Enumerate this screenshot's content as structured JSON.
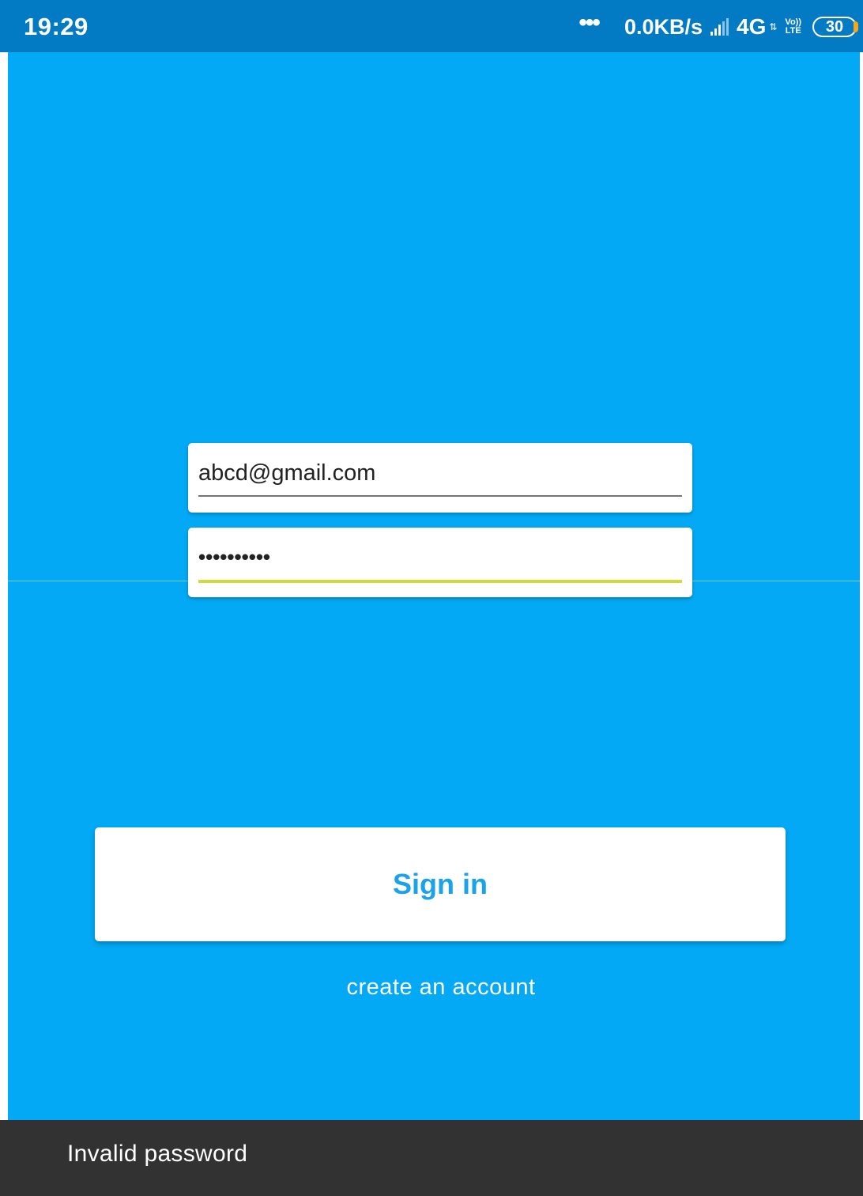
{
  "status_bar": {
    "time": "19:29",
    "dots": "•••",
    "speed": "0.0KB/s",
    "network": "4G",
    "volte_top": "Vo))",
    "volte_bottom": "LTE",
    "battery_level": "30",
    "battery_accent_color": "#f6a81c"
  },
  "login": {
    "email_value": "abcd@gmail.com",
    "password_mask": "••••••••••"
  },
  "buttons": {
    "sign_in_label": "Sign in",
    "create_account_label": "create an account"
  },
  "snackbar": {
    "message": "Invalid password"
  },
  "colors": {
    "status_bar": "#027bc4",
    "background": "#03a9f4",
    "accent_underline": "#cddc39",
    "sign_in_text": "#1aa3ea",
    "snackbar": "#323232"
  }
}
